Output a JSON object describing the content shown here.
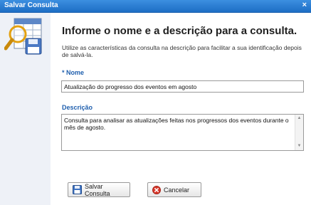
{
  "window": {
    "title": "Salvar Consulta",
    "close_glyph": "×"
  },
  "content": {
    "heading": "Informe o nome e a descrição para a consulta.",
    "subtext": "Utilize as características da consulta na descrição para facilitar a sua identificação depois de salvá-la.",
    "name_label": "* Nome",
    "name_value": "Atualização do progresso dos eventos em agosto",
    "description_label": "Descrição",
    "description_value": "Consulta para analisar as atualizações feitas nos progressos dos eventos durante o mês de agosto."
  },
  "buttons": {
    "save_label": "Salvar Consulta",
    "cancel_label": "Cancelar"
  },
  "icons": {
    "header": "save-query-icon",
    "save": "floppy-disk-icon",
    "cancel": "cancel-icon",
    "scroll_up": "scroll-up-arrow-icon",
    "scroll_down": "scroll-down-arrow-icon"
  },
  "colors": {
    "titlebar": "#1d6ec5",
    "label": "#1f5fae",
    "cancel_icon": "#d9382b"
  }
}
